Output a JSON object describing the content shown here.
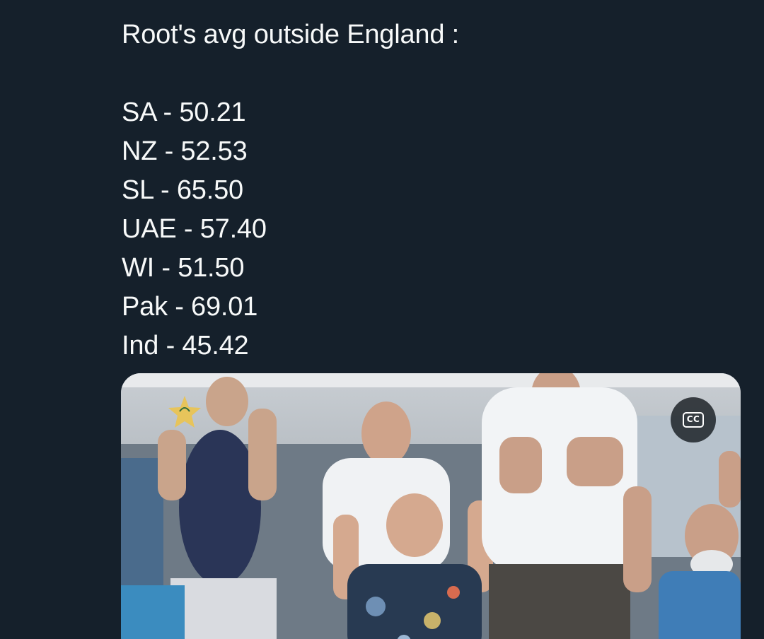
{
  "tweet": {
    "heading": "Root's avg outside England :",
    "lines": [
      "SA - 50.21",
      "NZ - 52.53",
      "SL - 65.50",
      "UAE - 57.40",
      "WI - 51.50",
      "Pak - 69.01",
      "Ind - 45.42"
    ]
  },
  "media": {
    "type": "video",
    "description_icon": "pakistan-cricket-star-logo",
    "cc_label": "CC"
  },
  "colors": {
    "background": "#15202b",
    "text": "#f7f9f9",
    "star": "#e7c45b"
  }
}
